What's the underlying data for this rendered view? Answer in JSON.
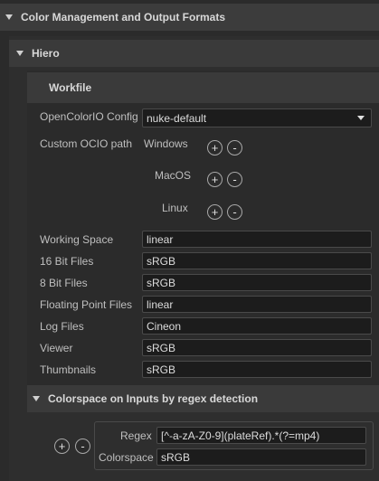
{
  "sections": {
    "color_mgmt": "Color Management and Output Formats",
    "hiero": "Hiero",
    "workfile": "Workfile"
  },
  "ocio": {
    "config_label": "OpenColorIO Config",
    "config_value": "nuke-default",
    "custom_path_label": "Custom OCIO path",
    "windows": "Windows",
    "macos": "MacOS",
    "linux": "Linux"
  },
  "buttons": {
    "add": "+",
    "remove": "-"
  },
  "fields": [
    {
      "label": "Working Space",
      "value": "linear"
    },
    {
      "label": "16 Bit Files",
      "value": "sRGB"
    },
    {
      "label": "8 Bit Files",
      "value": "sRGB"
    },
    {
      "label": "Floating Point Files",
      "value": "linear"
    },
    {
      "label": "Log Files",
      "value": "Cineon"
    },
    {
      "label": "Viewer",
      "value": "sRGB"
    },
    {
      "label": "Thumbnails",
      "value": "sRGB"
    }
  ],
  "regex_section": {
    "title": "Colorspace on Inputs by regex detection",
    "regex_label": "Regex",
    "regex_value": "[^-a-zA-Z0-9](plateRef).*(?=mp4)",
    "colorspace_label": "Colorspace",
    "colorspace_value": "sRGB"
  }
}
